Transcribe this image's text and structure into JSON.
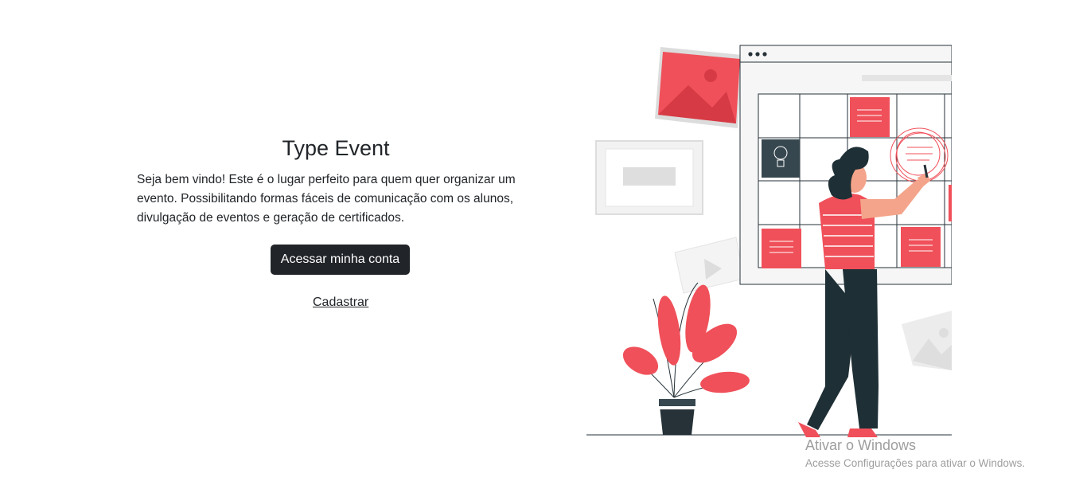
{
  "hero": {
    "title": "Type Event",
    "description": "Seja bem vindo! Este é o lugar perfeito para quem quer organizar um evento. Possibilitando formas fáceis de comunicação com os alunos, divulgação de eventos e geração de certificados.",
    "login_button": "Acessar minha conta",
    "register_link": "Cadastrar"
  },
  "illustration": {
    "icon": "woman-planning-board-illustration",
    "colors": {
      "accent": "#f0505a",
      "dark": "#1e2f35",
      "light": "#eeeeee"
    }
  },
  "os_watermark": {
    "title": "Ativar o Windows",
    "subtitle": "Acesse Configurações para ativar o Windows."
  }
}
